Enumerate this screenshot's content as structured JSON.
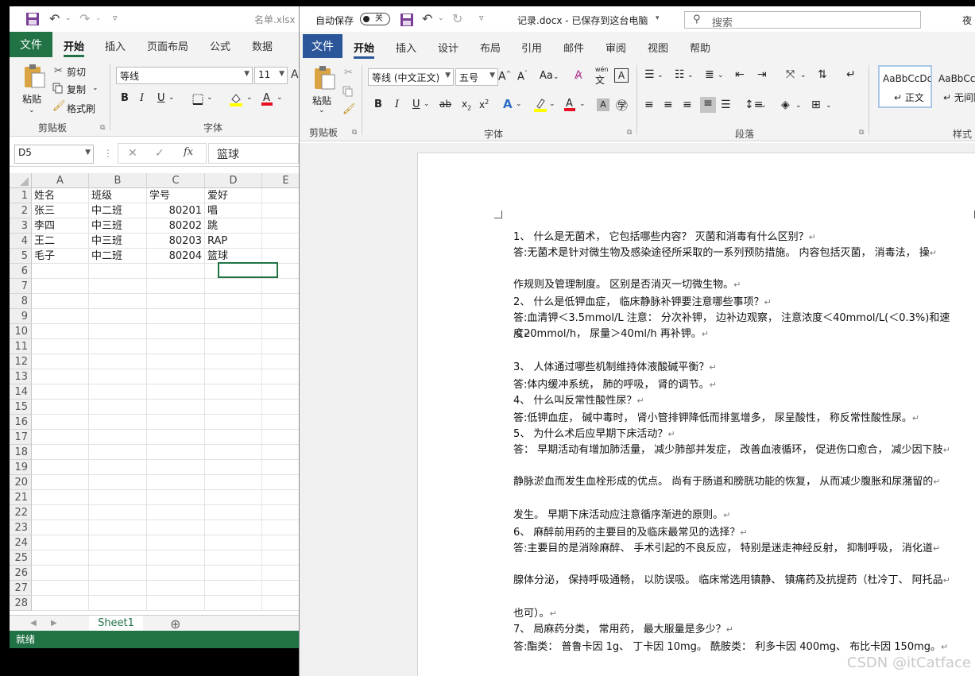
{
  "excel": {
    "title": "名单.xlsx",
    "tabs": [
      "文件",
      "开始",
      "插入",
      "页面布局",
      "公式",
      "数据"
    ],
    "active_tab": "开始",
    "clipboard": {
      "paste": "粘贴",
      "cut": "剪切",
      "copy": "复制",
      "format_painter": "格式刷",
      "group": "剪贴板"
    },
    "font": {
      "name": "等线",
      "size": "11",
      "group": "字体"
    },
    "name_box": "D5",
    "formula_value": "篮球",
    "fx": "fx",
    "columns": [
      "A",
      "B",
      "C",
      "D",
      "E"
    ],
    "rows": [
      "1",
      "2",
      "3",
      "4",
      "5",
      "6",
      "7",
      "8",
      "9",
      "10",
      "11",
      "12",
      "13",
      "14",
      "15",
      "16",
      "17",
      "18",
      "19",
      "20",
      "21",
      "22",
      "23",
      "24",
      "25",
      "26",
      "27",
      "28"
    ],
    "cells": [
      [
        "姓名",
        "班级",
        "学号",
        "爱好"
      ],
      [
        "张三",
        "中二班",
        "80201",
        "唱"
      ],
      [
        "李四",
        "中三班",
        "80202",
        "跳"
      ],
      [
        "王二",
        "中三班",
        "80203",
        "RAP"
      ],
      [
        "毛子",
        "中二班",
        "80204",
        "篮球"
      ]
    ],
    "sheet": "Sheet1",
    "status": "就绪"
  },
  "word": {
    "autosave": "自动保存",
    "autosave_state": "关",
    "title": "记录.docx - 已保存到这台电脑",
    "search_placeholder": "搜索",
    "user": "夜",
    "tabs": [
      "文件",
      "开始",
      "插入",
      "设计",
      "布局",
      "引用",
      "邮件",
      "审阅",
      "视图",
      "帮助"
    ],
    "active_tab": "开始",
    "clipboard": {
      "paste": "粘贴",
      "group": "剪贴板"
    },
    "font": {
      "name": "等线 (中文正文)",
      "size": "五号",
      "group": "字体",
      "aa": "Aa",
      "wen": "wén",
      "wen_char": "文",
      "a_box": "A"
    },
    "paragraph_group": "段落",
    "styles_group": "样式",
    "styles": [
      {
        "preview": "AaBbCcDd",
        "name": "正文"
      },
      {
        "preview": "AaBbCcD",
        "name": "无间隔"
      }
    ],
    "paragraphs": [
      "1、 什么是无菌术， 它包括哪些内容？ 灭菌和消毒有什么区别？",
      "答:无菌术是针对微生物及感染途径所采取的一系列预防措施。 内容包括灭菌， 消毒法， 操",
      "作规则及管理制度。 区别是否消灭一切微生物。",
      "2、 什么是低钾血症， 临床静脉补钾要注意哪些事项？",
      "答:血清钾＜3.5mmol/L 注意： 分次补钾， 边补边观察， 注意浓度＜40mmol/L(＜0.3%)和速度",
      "＜20mmol/h， 尿量＞40ml/h 再补钾。",
      "3、 人体通过哪些机制维持体液酸碱平衡？",
      "答:体内缓冲系统， 肺的呼吸， 肾的调节。",
      "4、 什么叫反常性酸性尿？",
      "答:低钾血症， 碱中毒时， 肾小管排钾降低而排氢增多， 尿呈酸性， 称反常性酸性尿。",
      "5、 为什么术后应早期下床活动？",
      "答： 早期活动有增加肺活量， 减少肺部并发症， 改善血液循环， 促进伤口愈合， 减少因下肢",
      "静脉淤血而发生血栓形成的优点。 尚有于肠道和膀胱功能的恢复， 从而减少腹胀和尿潴留的",
      "发生。 早期下床活动应注意循序渐进的原则。",
      "6、 麻醉前用药的主要目的及临床最常见的选择？",
      "答:主要目的是消除麻醉、 手术引起的不良反应， 特别是迷走神经反射， 抑制呼吸， 消化道",
      "腺体分泌， 保持呼吸通畅， 以防误吸。 临床常选用镇静、 镇痛药及抗提药（杜冷丁、 阿托品",
      "也可）。",
      "7、 局麻药分类， 常用药， 最大服量是多少？",
      "答:酯类： 普鲁卡因 1g、 丁卡因 10mg。 酰胺类： 利多卡因 400mg、 布比卡因 150mg。"
    ],
    "pilcrow": "↵"
  },
  "watermark": "CSDN @itCatface"
}
